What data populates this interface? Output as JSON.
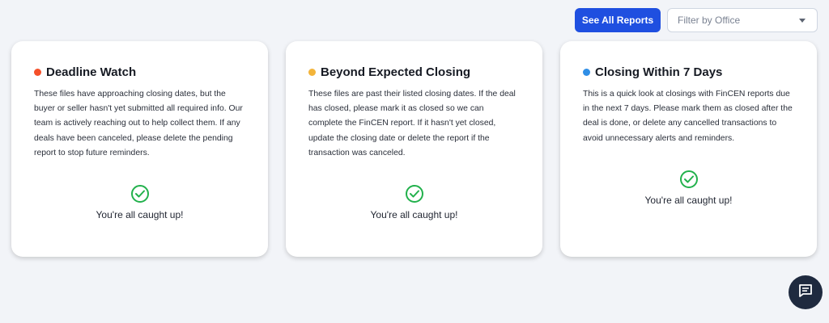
{
  "header": {
    "see_all_label": "See All Reports",
    "filter_placeholder": "Filter by Office"
  },
  "cards": [
    {
      "title": "Deadline Watch",
      "dot_color": "#f5502a",
      "description": "These files have approaching closing dates, but the buyer or seller hasn't yet submitted all required info. Our team is actively reaching out to help collect them. If any deals have been canceled, please delete the pending report to stop future reminders.",
      "status": "You're all caught up!"
    },
    {
      "title": "Beyond Expected Closing",
      "dot_color": "#f3b43a",
      "description": "These files are past their listed closing dates. If the deal has closed, please mark it as closed so we can complete the FinCEN report. If it hasn't yet closed, update the closing date or delete the report if the transaction was canceled.",
      "status": "You're all caught up!"
    },
    {
      "title": "Closing Within 7 Days",
      "dot_color": "#2f8ee6",
      "description": "This is a quick look at closings with FinCEN reports due in the next 7 days. Please mark them as closed after the deal is done, or delete any cancelled transactions to avoid unnecessary alerts and reminders.",
      "status": "You're all caught up!"
    }
  ],
  "icons": {
    "check": "check-circle-icon",
    "chat": "chat-icon",
    "caret": "chevron-down-icon"
  },
  "colors": {
    "primary": "#1f4fe0",
    "success": "#22b14c",
    "chat_bg": "#1f2a3f"
  }
}
